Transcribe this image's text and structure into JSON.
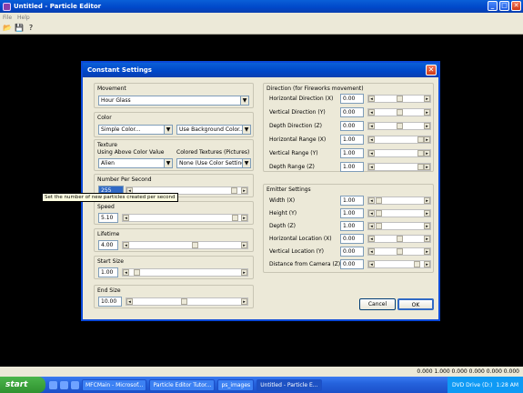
{
  "window": {
    "title": "Untitled - Particle Editor"
  },
  "menu": [
    "File",
    "Help"
  ],
  "toolbar": {
    "open": "📂",
    "save": "💾",
    "help": "?"
  },
  "status_text": "0.000 1.000 0.000 0.000 0.000 0.000",
  "dialog": {
    "title": "Constant Settings",
    "close": "✕",
    "movement": {
      "label": "Movement",
      "value": "Hour Glass"
    },
    "color": {
      "label": "Color",
      "combo1": "Simple Color...",
      "combo2": "Use Background Color..."
    },
    "texture": {
      "label": "Texture",
      "col1_label": "Using Above Color Value",
      "col2_label": "Colored Textures (Pictures)",
      "combo1": "Alien",
      "combo2": "None (Use Color Settings)"
    },
    "nps": {
      "label": "Number Per Second",
      "value": "255"
    },
    "tooltip": "Set the number of new particles created per second",
    "speed": {
      "label": "Speed",
      "value": "5.10"
    },
    "lifetime": {
      "label": "Lifetime",
      "value": "4.00"
    },
    "start_size": {
      "label": "Start Size",
      "value": "1.00"
    },
    "end_size": {
      "label": "End Size",
      "value": "10.00"
    },
    "direction": {
      "label": "Direction (for Fireworks movement)",
      "rows": [
        {
          "label": "Horizontal Direction (X)",
          "value": "0.00"
        },
        {
          "label": "Vertical Direction (Y)",
          "value": "0.00"
        },
        {
          "label": "Depth Direction (Z)",
          "value": "0.00"
        },
        {
          "label": "Horizontal Range (X)",
          "value": "1.00"
        },
        {
          "label": "Vertical Range (Y)",
          "value": "1.00"
        },
        {
          "label": "Depth Range (Z)",
          "value": "1.00"
        }
      ]
    },
    "emitter": {
      "label": "Emitter Settings",
      "rows": [
        {
          "label": "Width (X)",
          "value": "1.00"
        },
        {
          "label": "Height (Y)",
          "value": "1.00"
        },
        {
          "label": "Depth (Z)",
          "value": "1.00"
        },
        {
          "label": "Horizontal Location (X)",
          "value": "0.00"
        },
        {
          "label": "Vertical Location (Y)",
          "value": "0.00"
        },
        {
          "label": "Distance from Camera (Z)",
          "value": "0.00"
        }
      ]
    },
    "buttons": {
      "cancel": "Cancel",
      "ok": "OK"
    }
  },
  "taskbar": {
    "start": "start",
    "tasks": [
      "MFCMain - Microsof...",
      "Particle Editor Tutor...",
      "ps_images",
      "Untitled - Particle E..."
    ],
    "tray_text": "DVD Drive (D:)",
    "time": "1:28 AM"
  },
  "colors": {
    "titlebar": "#0047c8",
    "dialog_bg": "#ece9d8",
    "selection": "#316ac5",
    "taskbar": "#2563dd"
  }
}
